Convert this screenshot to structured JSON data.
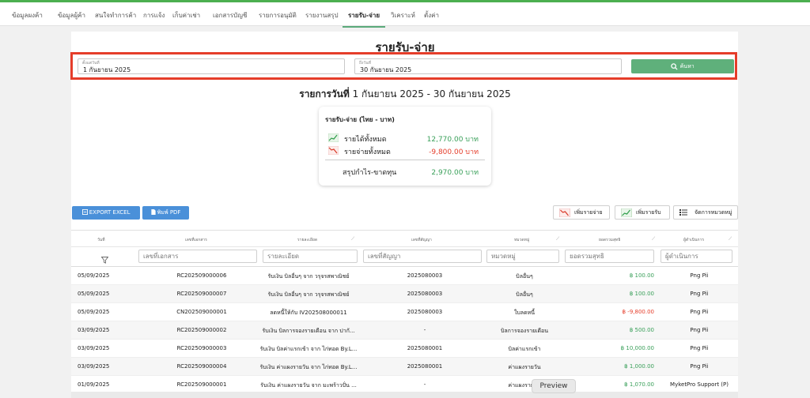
{
  "nav": {
    "items": [
      "ข้อมูลผงค้า",
      "ข้อมูลผู้ค้า",
      "สนใจทำการค้า",
      "การแจ้ง",
      "เก็บค่าเช่า",
      "เอกสารบัญชี",
      "รายการอนุมัติ",
      "รายงานสรุป",
      "รายรับ-จ่าย",
      "วิเคราะห์",
      "ตั้งค่า"
    ],
    "active_index": 8
  },
  "page": {
    "title": "รายรับ-จ่าย"
  },
  "filters": {
    "start_label": "ตั้งแต่วันที่",
    "start_value": "1 กันยายน 2025",
    "end_label": "ถึงวันที่",
    "end_value": "30 กันยายน 2025",
    "search_label": "ค้นหา"
  },
  "range": {
    "prefix": "รายการวันที่",
    "text": " 1 กันยายน 2025 - 30 กันยายน 2025"
  },
  "summary": {
    "heading": "รายรับ-จ่าย (ไทย - บาท)",
    "income_label": "รายได้ทั้งหมด",
    "income_value": "12,770.00 บาท",
    "expense_label": "รายจ่ายทั้งหมด",
    "expense_value": "-9,800.00 บาท",
    "profit_label": "สรุปกำไร-ขาดทุน",
    "profit_value": "2,970.00 บาท"
  },
  "actions": {
    "export_excel": "EXPORT EXCEL",
    "print_pdf": "พิมพ์ PDF",
    "add_expense": "เพิ่มรายจ่าย",
    "add_income": "เพิ่มรายรับ",
    "manage_categories": "จัดการหมวดหมู่"
  },
  "table": {
    "headers": [
      "วันที่",
      "เลขที่เอกสาร",
      "รายละเอียด",
      "เลขที่สัญญา",
      "หมวดหมู่",
      "ยอดรวมสุทธิ",
      "ผู้ดำเนินการ"
    ],
    "filter_placeholders": [
      "เลขที่เอกสาร",
      "รายละเอียด",
      "เลขที่สัญญา",
      "หมวดหมู่",
      "ยอดรวมสุทธิ",
      "ผู้ดำเนินการ"
    ],
    "rows": [
      {
        "date": "05/09/2025",
        "doc": "RC202509000006",
        "detail": "รับเงิน บิลอื่นๆ จาก วรุจรสพาณิชย์",
        "contract": "2025080003",
        "category": "บิลอื่นๆ",
        "amount": "฿ 100.00",
        "amount_type": "in",
        "by": "Png Pii"
      },
      {
        "date": "05/09/2025",
        "doc": "RC202509000007",
        "detail": "รับเงิน บิลอื่นๆ จาก วรุจรสพาณิชย์",
        "contract": "2025080003",
        "category": "บิลอื่นๆ",
        "amount": "฿ 100.00",
        "amount_type": "in",
        "by": "Png Pii"
      },
      {
        "date": "05/09/2025",
        "doc": "CN202509000001",
        "detail": "ลดหนี้ให้กับ IV202508000011",
        "contract": "2025080003",
        "category": "ใบลดหนี้",
        "amount": "฿ -9,800.00",
        "amount_type": "out",
        "by": "Png Pii"
      },
      {
        "date": "03/09/2025",
        "doc": "RC202509000002",
        "detail": "รับเงิน บิลการจองรายเดือน จาก ปากั...",
        "contract": "-",
        "category": "บิลการจองรายเดือน",
        "amount": "฿ 500.00",
        "amount_type": "in",
        "by": "Png Pii"
      },
      {
        "date": "03/09/2025",
        "doc": "RC202509000003",
        "detail": "รับเงิน บิลค่าแรกเข้า จาก ไก่ทอด By.L...",
        "contract": "2025080001",
        "category": "บิลค่าแรกเข้า",
        "amount": "฿ 10,000.00",
        "amount_type": "in",
        "by": "Png Pii"
      },
      {
        "date": "03/09/2025",
        "doc": "RC202509000004",
        "detail": "รับเงิน ค่าแผงรายวัน จาก ไก่ทอด By.L...",
        "contract": "2025080001",
        "category": "ค่าแผงรายวัน",
        "amount": "฿ 1,000.00",
        "amount_type": "in",
        "by": "Png Pii"
      },
      {
        "date": "01/09/2025",
        "doc": "RC202509000001",
        "detail": "รับเงิน ค่าแผงรายวัน จาก มะพร้าวปั่น ...",
        "contract": "-",
        "category": "ค่าแผงรายวัน",
        "amount": "฿ 1,070.00",
        "amount_type": "in",
        "by": "MyketPro Support (P)"
      }
    ]
  },
  "preview": {
    "label": "Preview"
  },
  "colors": {
    "accent": "#4caf50",
    "search_button": "#5fb07b",
    "export_button": "#4a90d9",
    "highlight_border": "#e53d2a",
    "income": "#3aa05a",
    "expense": "#e53d2a"
  }
}
